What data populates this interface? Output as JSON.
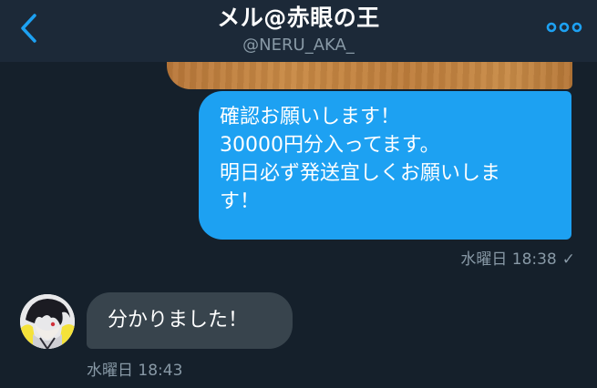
{
  "header": {
    "title": "メル@赤眼の王",
    "handle": "@NERU_AKA_",
    "back_icon": "chevron-left-icon",
    "more_icon": "more-horizontal-icon"
  },
  "conversation": {
    "sent": {
      "lines": [
        "確認お願いします！",
        "30000円分入ってます。",
        "明日必ず発送宜しくお願いしま",
        "す！"
      ],
      "timestamp": "水曜日 18:38",
      "status_icon": "checkmark-icon",
      "status_glyph": "✓"
    },
    "received": {
      "text": "分かりました！",
      "timestamp": "水曜日 18:43"
    }
  },
  "colors": {
    "background": "#15202b",
    "header": "#1c2938",
    "sent_bubble": "#1da1f2",
    "received_bubble": "#38444d",
    "accent": "#1da1f2",
    "meta_text": "#8899a6"
  }
}
